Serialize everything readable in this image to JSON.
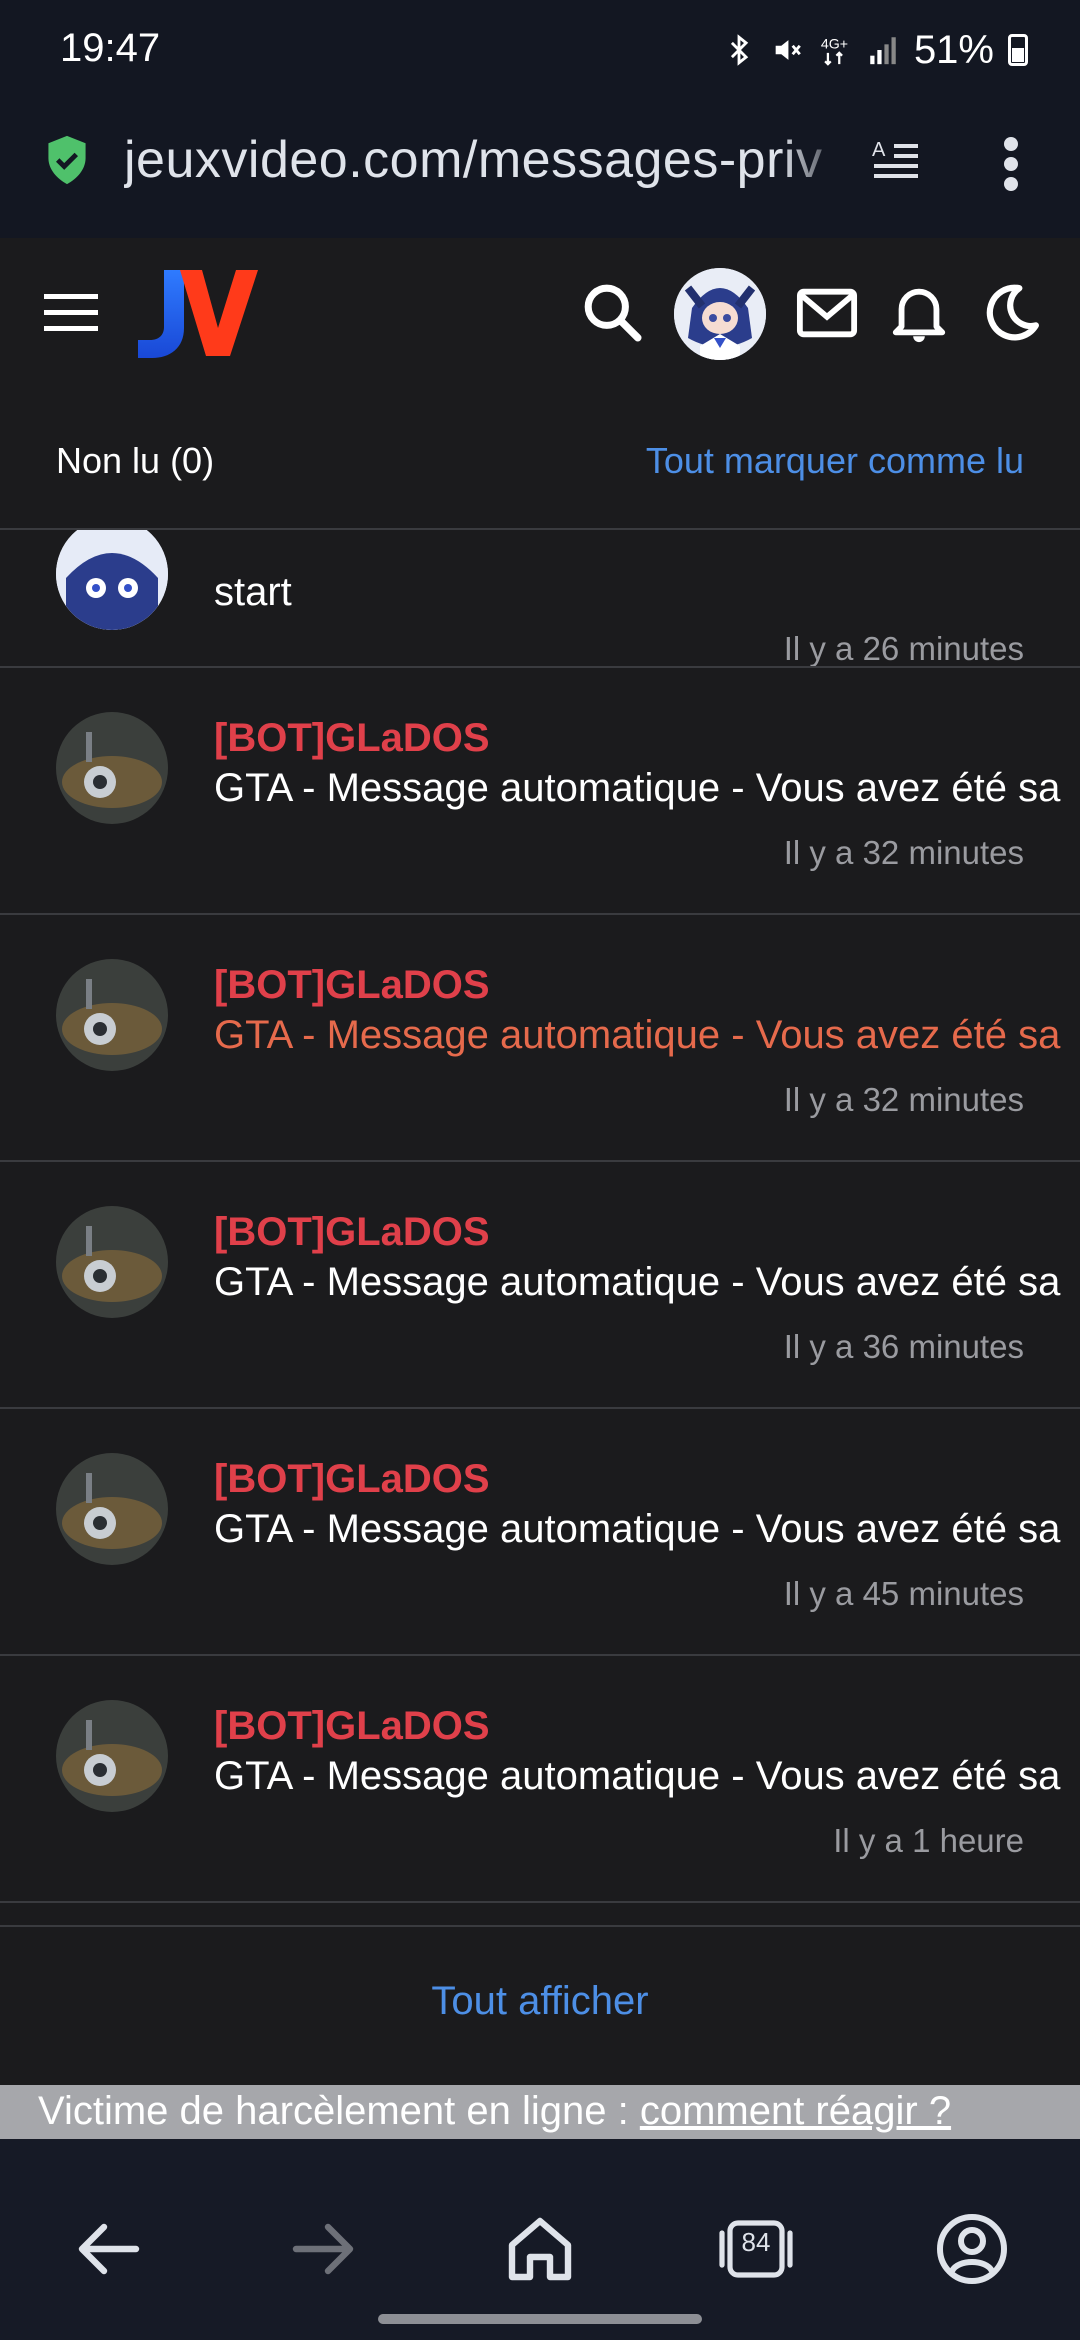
{
  "status_bar": {
    "time": "19:47",
    "battery": "51%"
  },
  "url_bar": {
    "url": "jeuxvideo.com/messages-priv"
  },
  "header": {
    "logo": "JV"
  },
  "tabs": {
    "unread": "Non lu (0)",
    "mark_all_read": "Tout marquer comme lu"
  },
  "messages": [
    {
      "sender": "",
      "subject": "start",
      "time": "Il y a 26 minutes"
    },
    {
      "sender": "[BOT]GLaDOS",
      "subject": "GTA - Message automatique - Vous avez été sa",
      "time": "Il y a 32 minutes"
    },
    {
      "sender": "[BOT]GLaDOS",
      "subject": "GTA - Message automatique - Vous avez été sa",
      "time": "Il y a 32 minutes"
    },
    {
      "sender": "[BOT]GLaDOS",
      "subject": "GTA - Message automatique - Vous avez été sa",
      "time": "Il y a 36 minutes"
    },
    {
      "sender": "[BOT]GLaDOS",
      "subject": "GTA - Message automatique - Vous avez été sa",
      "time": "Il y a 45 minutes"
    },
    {
      "sender": "[BOT]GLaDOS",
      "subject": "GTA - Message automatique - Vous avez été sa",
      "time": "Il y a 1 heure"
    }
  ],
  "footer": {
    "show_all": "Tout afficher"
  },
  "banner": {
    "text": "Victime de harcèlement en ligne : ",
    "link": "comment réagir ?"
  },
  "browser_nav": {
    "tab_count": "84"
  },
  "colors": {
    "accent": "#4d8fe6",
    "sender": "#e0404a",
    "highlight_subject": "#e66a4c",
    "background": "#1b1b1d"
  }
}
